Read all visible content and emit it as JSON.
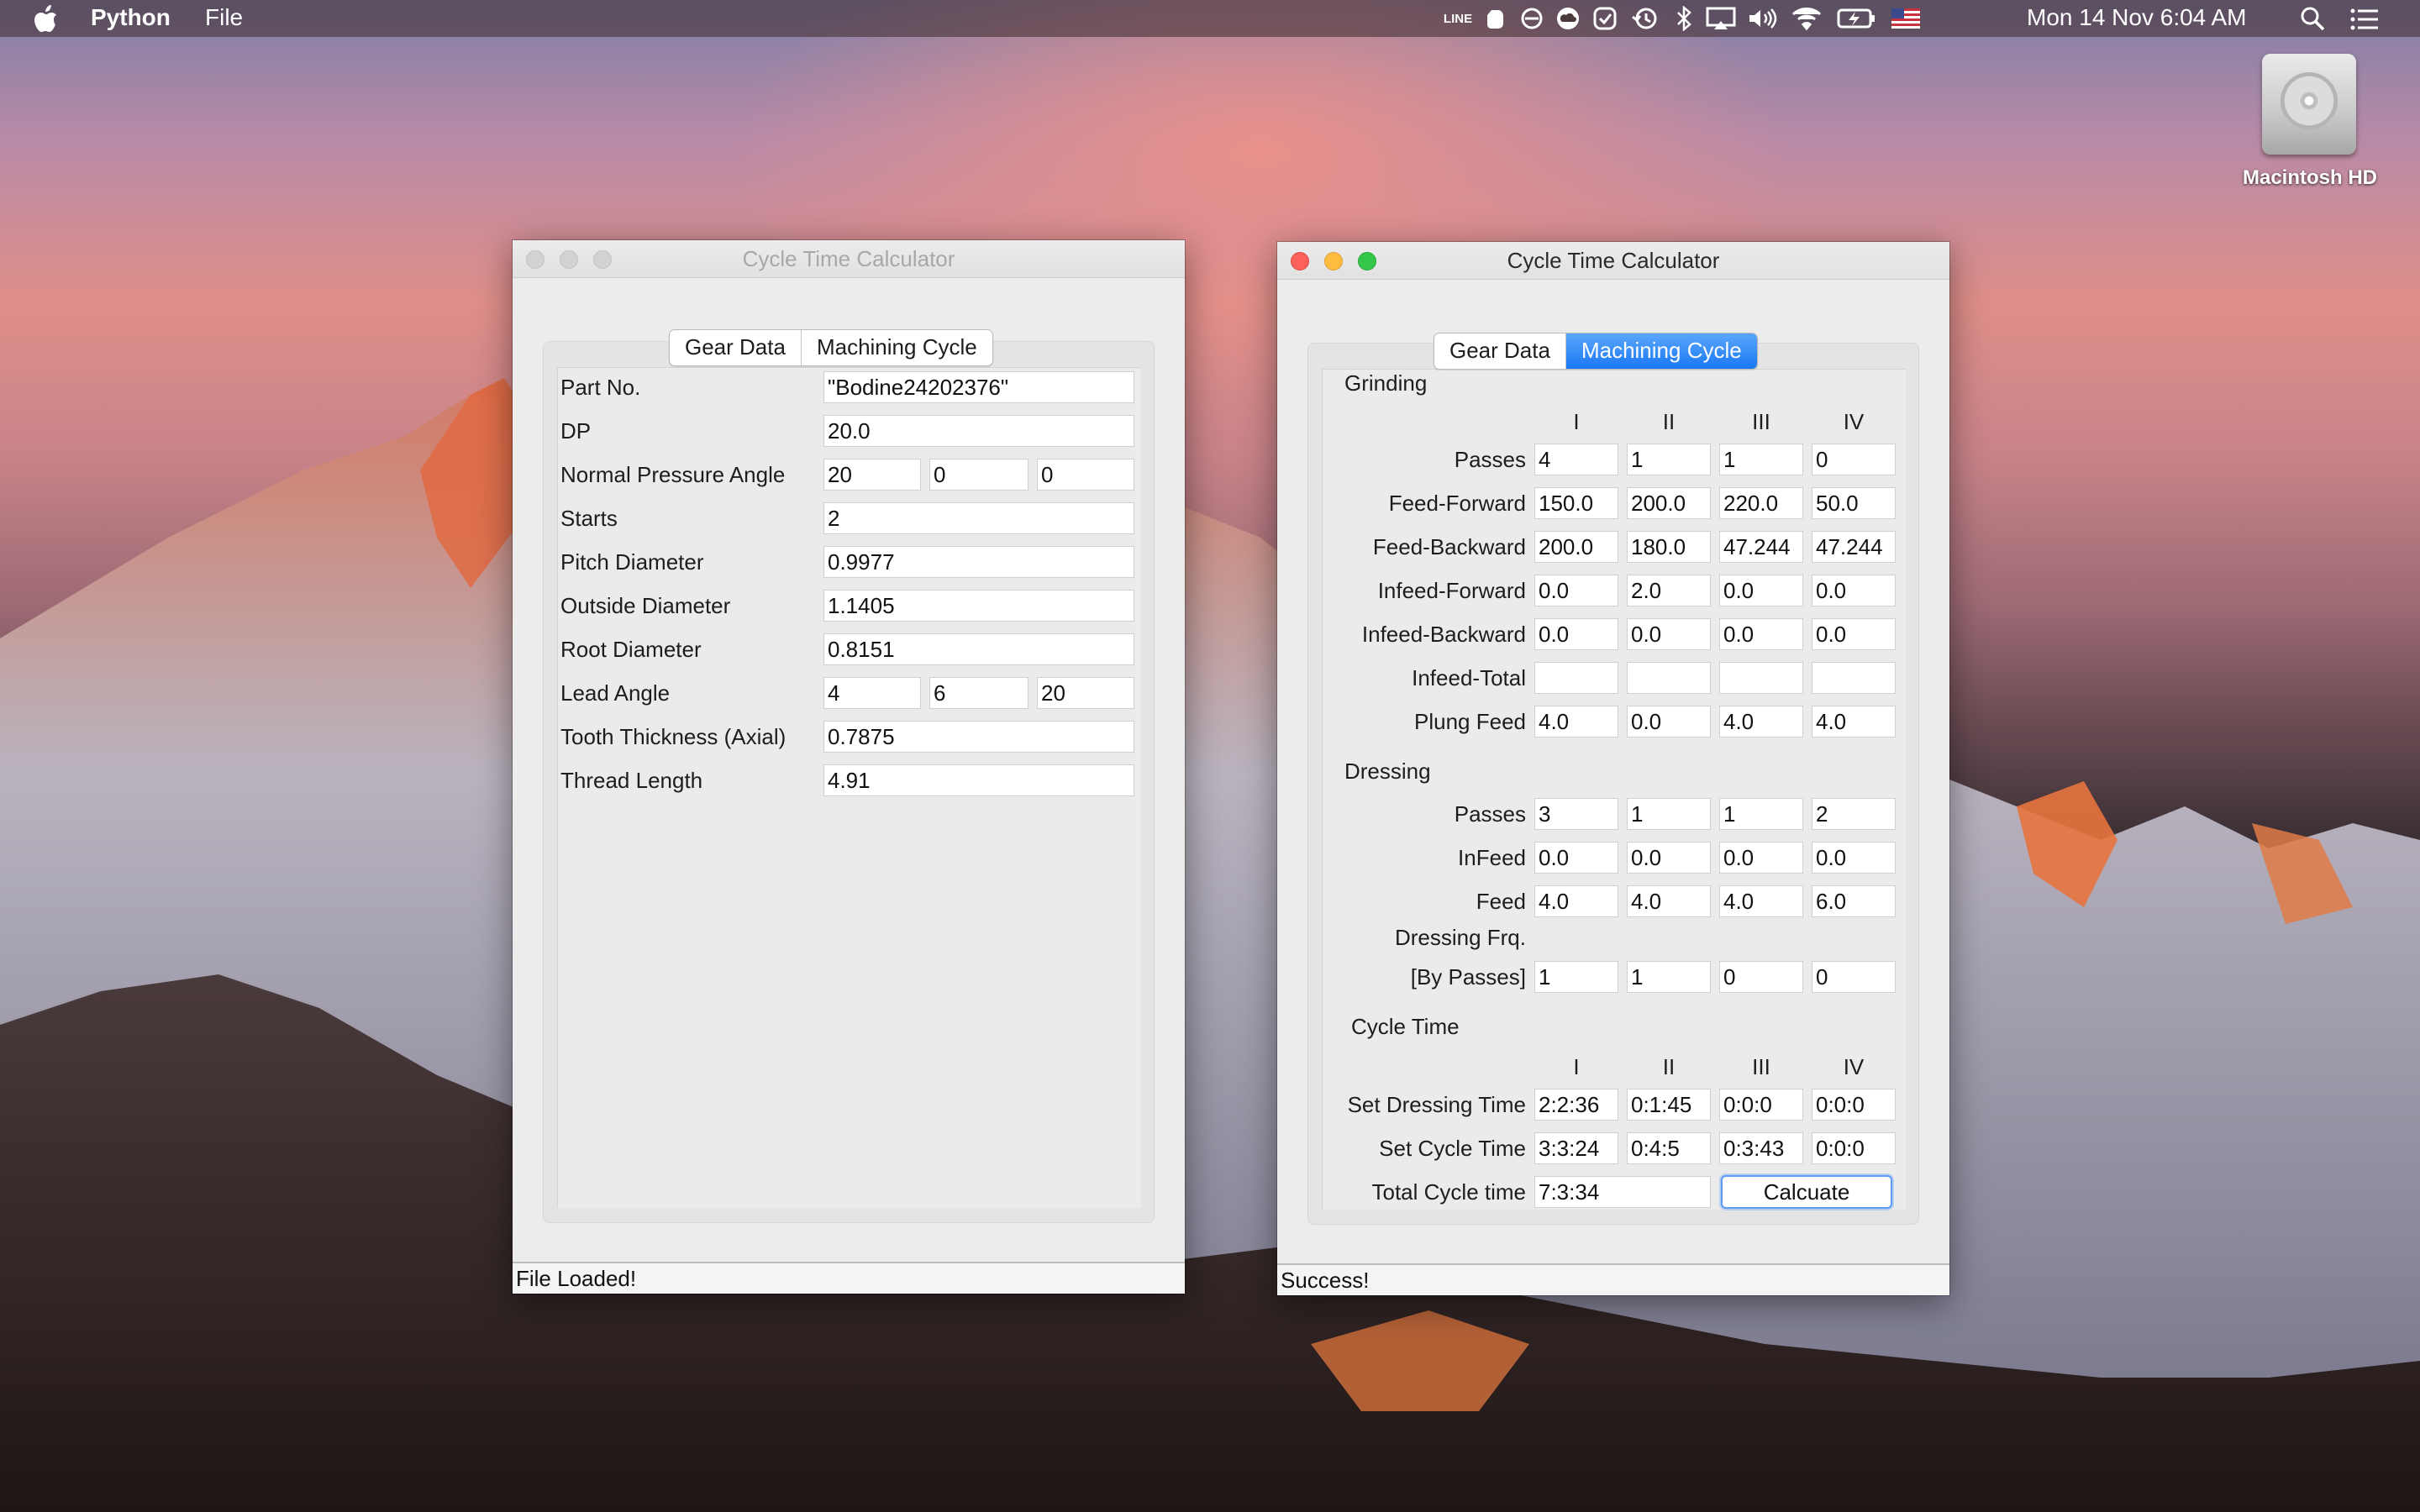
{
  "menubar": {
    "app_name": "Python",
    "menu_file": "File",
    "clock": "Mon 14 Nov  6:04 AM",
    "line_icon_text": "LINE"
  },
  "desktop": {
    "hd_label": "Macintosh HD"
  },
  "left_window": {
    "title": "Cycle Time Calculator",
    "tabs": [
      "Gear Data",
      "Machining Cycle"
    ],
    "rows": [
      {
        "label": "Part No.",
        "values": [
          "\"Bodine24202376\""
        ]
      },
      {
        "label": "DP",
        "values": [
          "20.0"
        ]
      },
      {
        "label": "Normal Pressure Angle",
        "values": [
          "20",
          "0",
          "0"
        ]
      },
      {
        "label": "Starts",
        "values": [
          "2"
        ]
      },
      {
        "label": "Pitch Diameter",
        "values": [
          "0.9977"
        ]
      },
      {
        "label": "Outside Diameter",
        "values": [
          "1.1405"
        ]
      },
      {
        "label": "Root Diameter",
        "values": [
          "0.8151"
        ]
      },
      {
        "label": "Lead Angle",
        "values": [
          "4",
          "6",
          "20"
        ]
      },
      {
        "label": "Tooth Thickness (Axial)",
        "values": [
          "0.7875"
        ]
      },
      {
        "label": "Thread Length",
        "values": [
          "4.91"
        ]
      }
    ],
    "status": "File Loaded!"
  },
  "right_window": {
    "title": "Cycle Time Calculator",
    "tabs": [
      "Gear Data",
      "Machining Cycle"
    ],
    "grinding": {
      "heading": "Grinding",
      "columns": [
        "I",
        "II",
        "III",
        "IV"
      ],
      "rows": [
        {
          "label": "Passes",
          "values": [
            "4",
            "1",
            "1",
            "0"
          ]
        },
        {
          "label": "Feed-Forward",
          "values": [
            "150.0",
            "200.0",
            "220.0",
            "50.0"
          ]
        },
        {
          "label": "Feed-Backward",
          "values": [
            "200.0",
            "180.0",
            "47.244",
            "47.244"
          ]
        },
        {
          "label": "Infeed-Forward",
          "values": [
            "0.0",
            "2.0",
            "0.0",
            "0.0"
          ]
        },
        {
          "label": "Infeed-Backward",
          "values": [
            "0.0",
            "0.0",
            "0.0",
            "0.0"
          ]
        },
        {
          "label": "Infeed-Total",
          "values": [
            "",
            "",
            "",
            ""
          ]
        },
        {
          "label": "Plung Feed",
          "values": [
            "4.0",
            "0.0",
            "4.0",
            "4.0"
          ]
        }
      ]
    },
    "dressing": {
      "heading": "Dressing",
      "rows": [
        {
          "label": "Passes",
          "values": [
            "3",
            "1",
            "1",
            "2"
          ]
        },
        {
          "label": "InFeed",
          "values": [
            "0.0",
            "0.0",
            "0.0",
            "0.0"
          ]
        },
        {
          "label": "Feed",
          "values": [
            "4.0",
            "4.0",
            "4.0",
            "6.0"
          ]
        }
      ],
      "frq_label_1": "Dressing Frq.",
      "frq_label_2": "[By Passes]",
      "frq_values": [
        "1",
        "1",
        "0",
        "0"
      ]
    },
    "cycle_time": {
      "heading": "Cycle Time",
      "columns": [
        "I",
        "II",
        "III",
        "IV"
      ],
      "rows": [
        {
          "label": "Set Dressing Time",
          "values": [
            "2:2:36",
            "0:1:45",
            "0:0:0",
            "0:0:0"
          ]
        },
        {
          "label": "Set Cycle Time",
          "values": [
            "3:3:24",
            "0:4:5",
            "0:3:43",
            "0:0:0"
          ]
        }
      ],
      "total_label": "Total Cycle time",
      "total_value": "7:3:34",
      "calc_button": "Calcuate"
    },
    "status": "Success!"
  }
}
